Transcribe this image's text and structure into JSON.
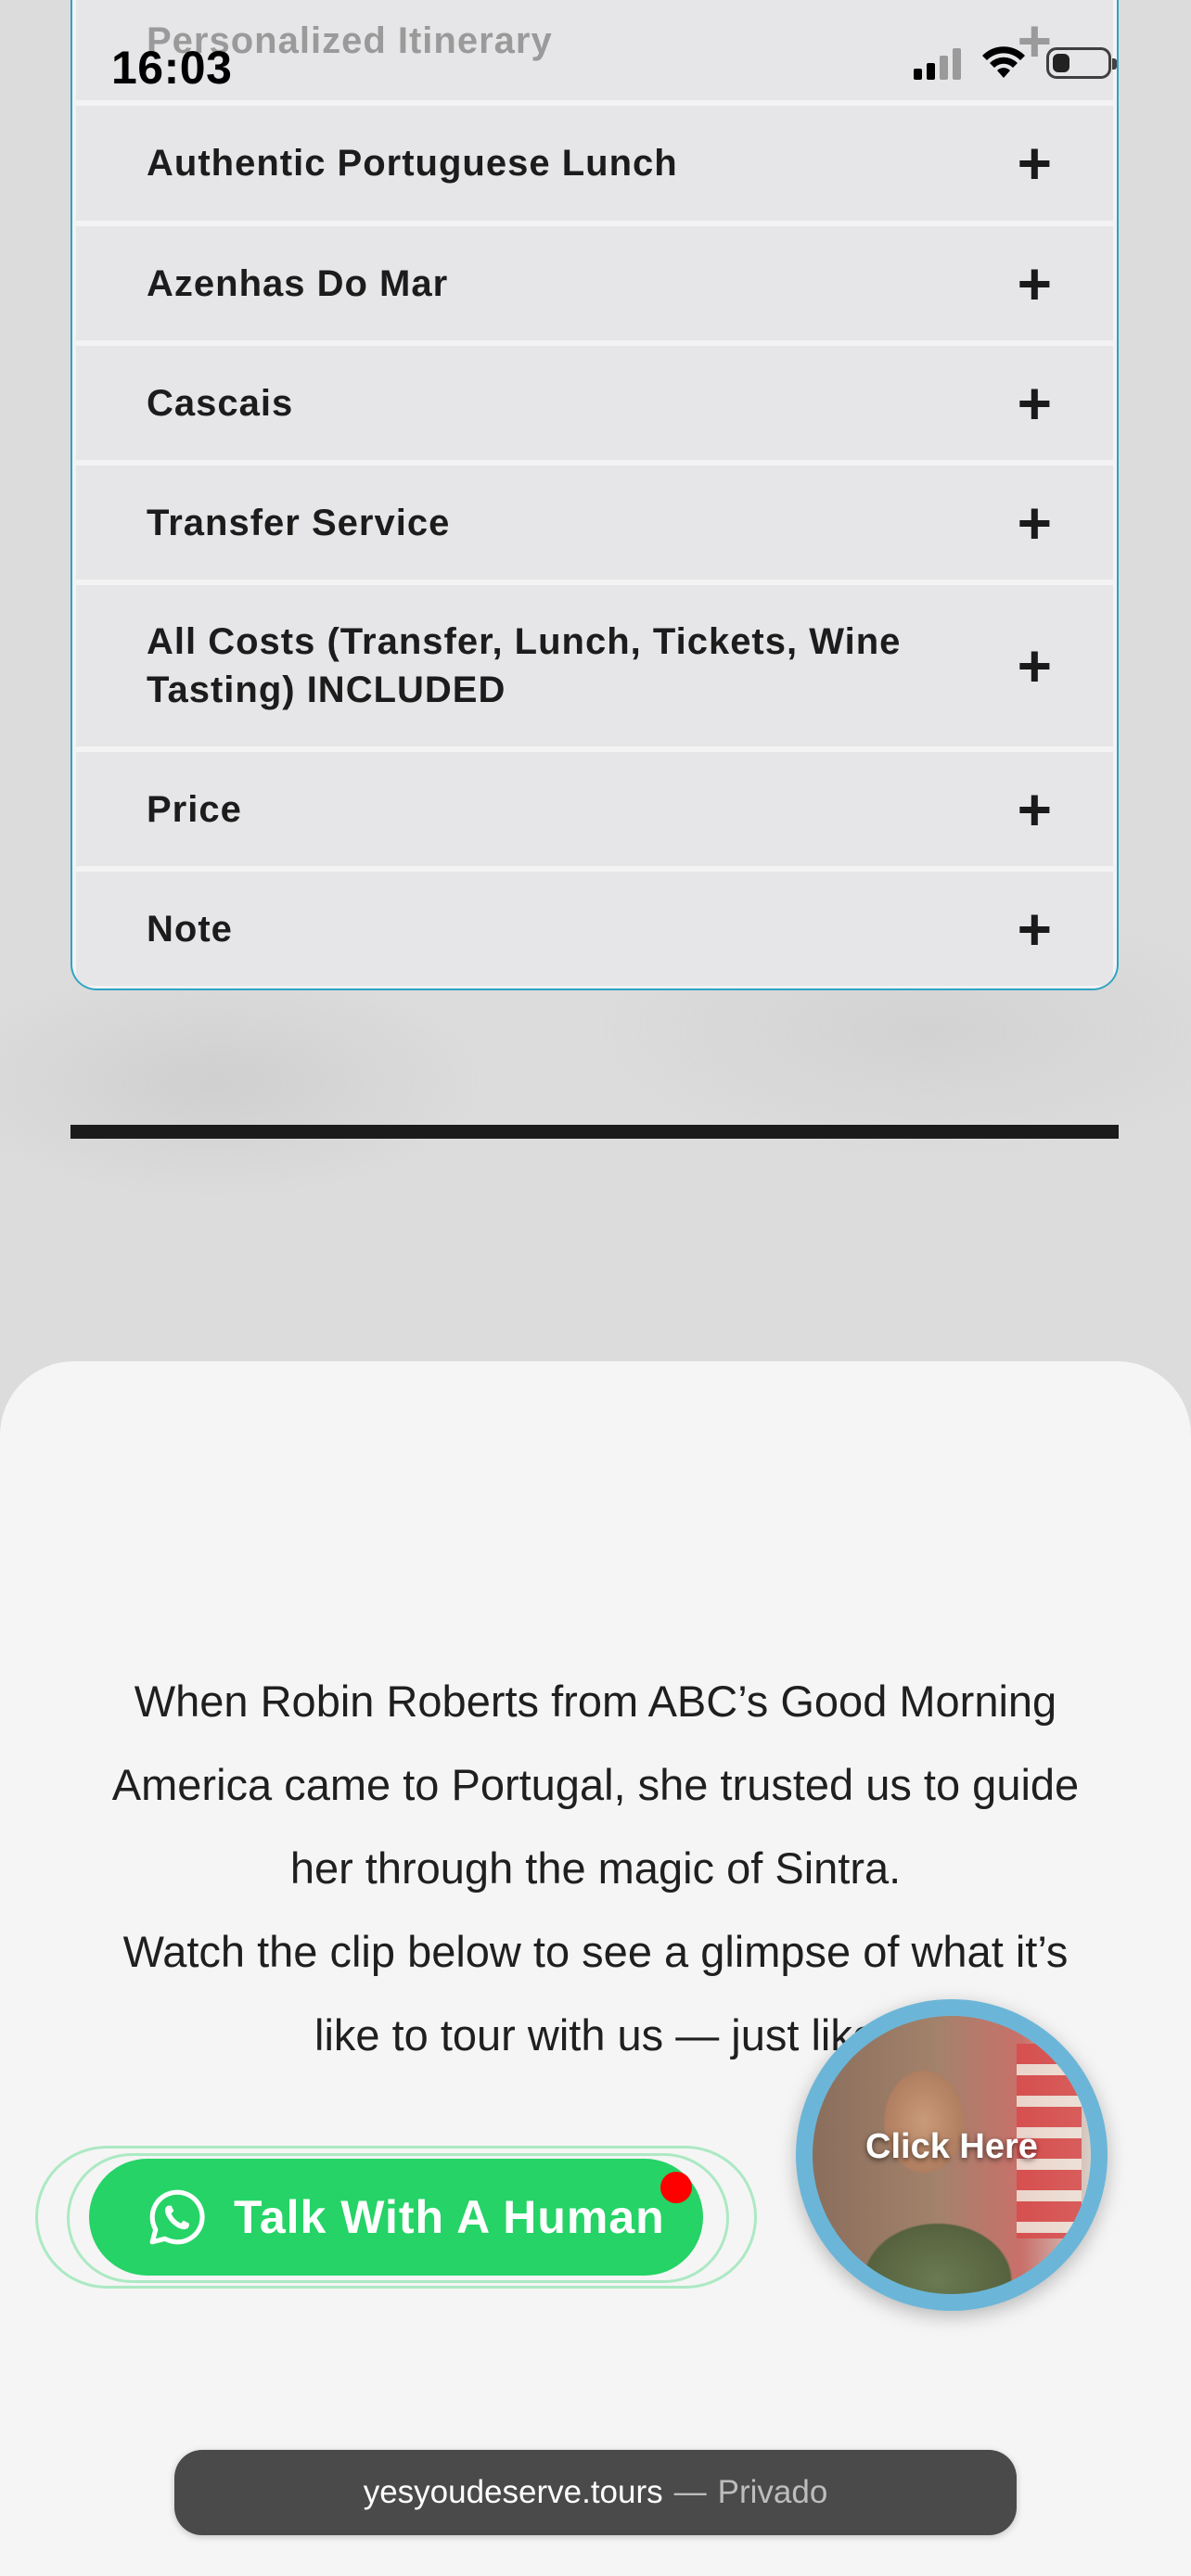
{
  "status_bar": {
    "time": "16:03"
  },
  "accordion": {
    "items": [
      {
        "label": "Personalized Itinerary",
        "icon": "plus-icon"
      },
      {
        "label": "Authentic Portuguese Lunch",
        "icon": "plus-icon"
      },
      {
        "label": "Azenhas Do Mar",
        "icon": "plus-icon"
      },
      {
        "label": "Cascais",
        "icon": "plus-icon"
      },
      {
        "label": "Transfer Service",
        "icon": "plus-icon"
      },
      {
        "label": "All Costs (Transfer, Lunch, Tickets, Wine Tasting) INCLUDED",
        "icon": "plus-icon"
      },
      {
        "label": "Price",
        "icon": "plus-icon"
      },
      {
        "label": "Note",
        "icon": "plus-icon"
      }
    ],
    "plus_glyph": "+",
    "border_color": "#2fa3c2"
  },
  "testimonial": {
    "paragraph_1": "When Robin Roberts from ABC’s Good Morning America came to Portugal, she trusted us to guide her through the magic of Sintra.",
    "paragraph_2": "Watch the clip below to see a glimpse of what it’s like to tour with us — just like"
  },
  "whatsapp_cta": {
    "label": "Talk With A Human",
    "icon": "whatsapp-icon",
    "color": "#25d366",
    "notification_color": "#ff0000"
  },
  "video_bubble": {
    "label": "Click Here",
    "ring_color": "#6bb6d8"
  },
  "browser": {
    "domain": "yesyoudeserve.tours",
    "separator": "—",
    "mode": "Privado"
  }
}
